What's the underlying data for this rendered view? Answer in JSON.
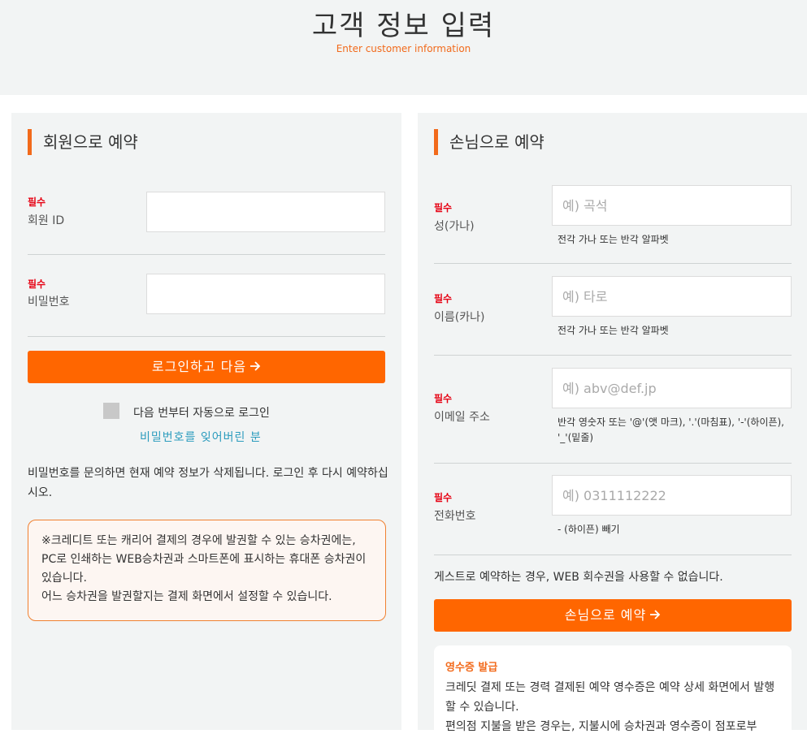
{
  "header": {
    "title": "고객 정보 입력",
    "subtitle": "Enter customer information"
  },
  "member": {
    "section_title": "회원으로 예약",
    "required_label": "필수",
    "member_id_label": "회원 ID",
    "member_id_value": "",
    "password_label": "비밀번호",
    "password_value": "",
    "login_button": "로그인하고 다음",
    "auto_login_label": "다음 번부터 자동으로 로그인",
    "auto_login_checked": false,
    "forgot_password_link": "비밀번호를 잊어버린 분",
    "notice": "비밀번호를 문의하면 현재 예약 정보가 삭제됩니다. 로그인 후 다시 예약하십시오.",
    "info_box": "※크레디트 또는 캐리어 결제의 경우에 발권할 수 있는 승차권에는, PC로 인쇄하는 WEB승차권과 스마트폰에 표시하는 휴대폰 승차권이 있습니다.\n어느 승차권을 발권할지는 결제 화면에서 설정할 수 있습니다."
  },
  "guest": {
    "section_title": "손님으로 예약",
    "required_label": "필수",
    "last_name_label": "성(가나)",
    "last_name_placeholder": "예) 곡석",
    "last_name_hint": "전각 가나 또는 반각 알파벳",
    "first_name_label": "이름(카나)",
    "first_name_placeholder": "예) 타로",
    "first_name_hint": "전각 가나 또는 반각 알파벳",
    "email_label": "이메일 주소",
    "email_placeholder": "예) abv@def.jp",
    "email_hint": "반각 영숫자 또는 '@'(앳 마크), '.'(마침표), '-'(하이픈), '_'(밑줄)",
    "phone_label": "전화번호",
    "phone_placeholder": "예) 0311112222",
    "phone_hint": "- (하이픈) 빼기",
    "notice": "게스트로 예약하는 경우, WEB 회수권을 사용할 수 없습니다.",
    "guest_button": "손님으로 예약",
    "receipt_title": "영수증 발급",
    "receipt_text": "크레딧 결제 또는 경력 결제된 예약 영수증은 예약 상세 화면에서 발행할 수 있습니다.\n편의점 지불을 받은 경우는, 지불시에 승차권과 영수증이 점포로부"
  },
  "icons": {
    "button_arrow": "arrow-right-icon"
  },
  "colors": {
    "accent": "#ff6600",
    "required": "#e60012",
    "link": "#2a9bbd",
    "panel_bg": "#f2f4f4"
  }
}
